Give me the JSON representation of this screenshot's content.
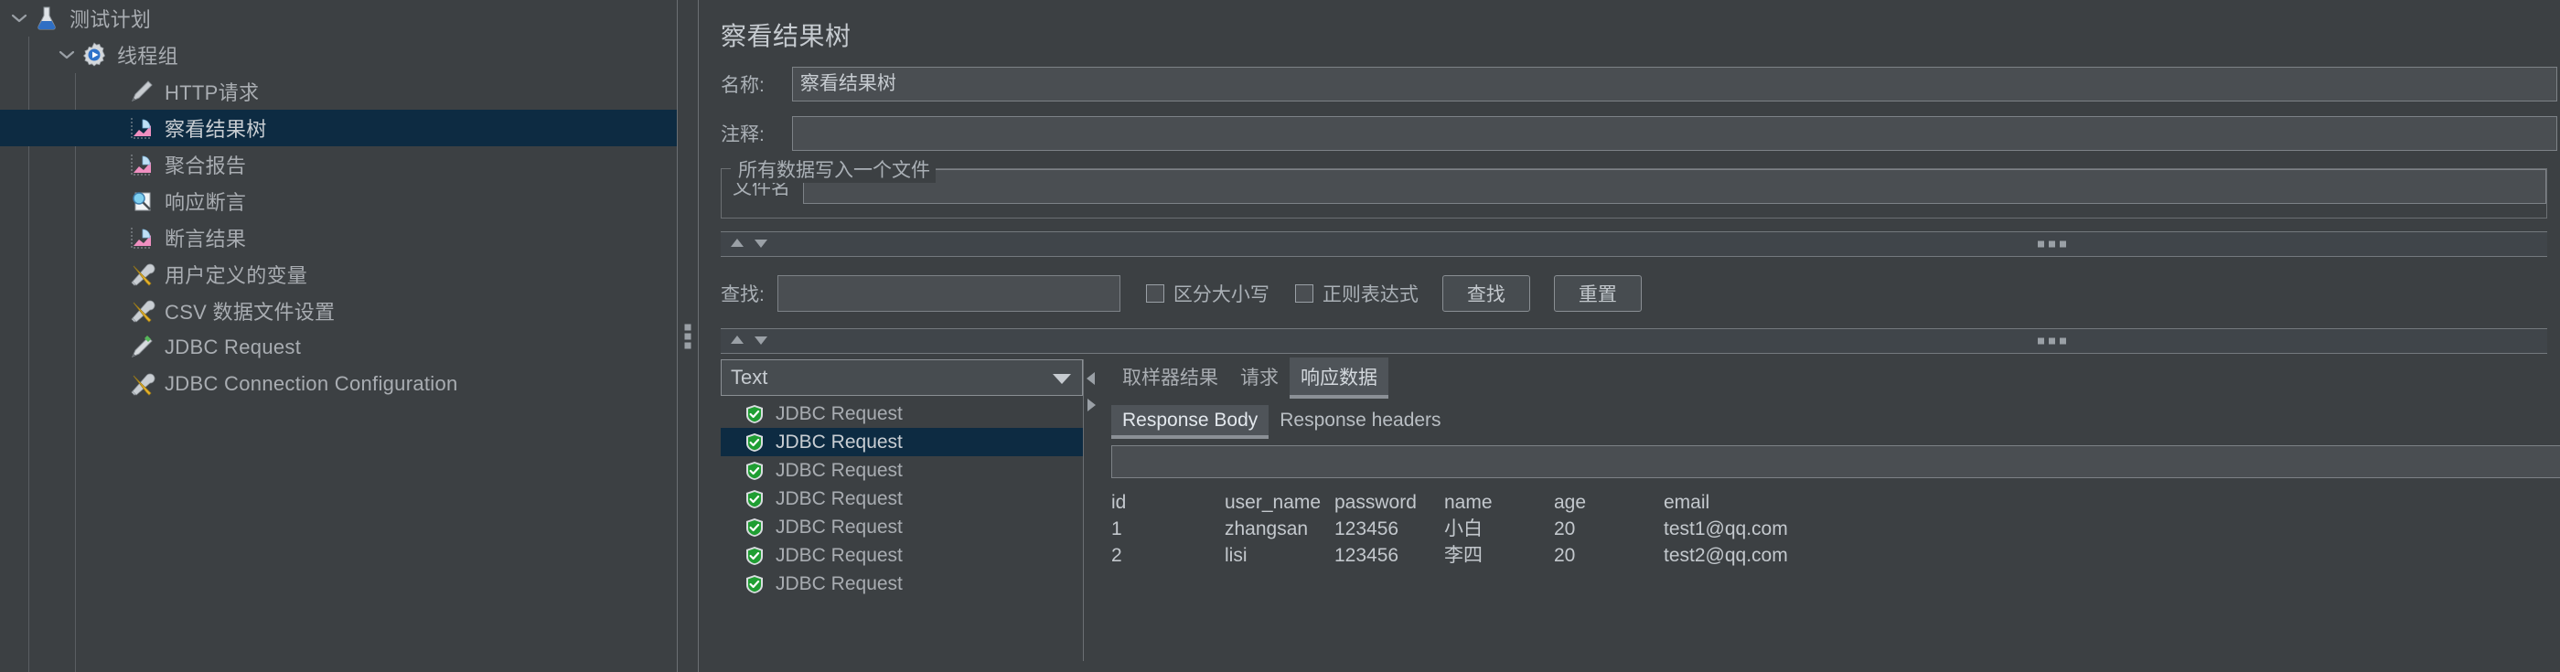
{
  "tree": {
    "items": [
      {
        "label": "测试计划",
        "icon": "flask-icon",
        "depth": 0,
        "twisty": "down",
        "selected": false
      },
      {
        "label": "线程组",
        "icon": "gear-play-icon",
        "depth": 1,
        "twisty": "down",
        "selected": false
      },
      {
        "label": "HTTP请求",
        "icon": "pencil-icon",
        "depth": 2,
        "twisty": "none",
        "selected": false
      },
      {
        "label": "察看结果树",
        "icon": "chart-icon",
        "depth": 2,
        "twisty": "none",
        "selected": true
      },
      {
        "label": "聚合报告",
        "icon": "chart-icon",
        "depth": 2,
        "twisty": "none",
        "selected": false
      },
      {
        "label": "响应断言",
        "icon": "magnifier-icon",
        "depth": 2,
        "twisty": "none",
        "selected": false
      },
      {
        "label": "断言结果",
        "icon": "chart-icon",
        "depth": 2,
        "twisty": "none",
        "selected": false
      },
      {
        "label": "用户定义的变量",
        "icon": "tools-icon",
        "depth": 2,
        "twisty": "none",
        "selected": false
      },
      {
        "label": "CSV 数据文件设置",
        "icon": "tools-icon",
        "depth": 2,
        "twisty": "none",
        "selected": false
      },
      {
        "label": "JDBC Request",
        "icon": "pencil-green-icon",
        "depth": 2,
        "twisty": "none",
        "selected": false
      },
      {
        "label": "JDBC Connection Configuration",
        "icon": "tools-icon",
        "depth": 2,
        "twisty": "none",
        "selected": false
      }
    ]
  },
  "panel": {
    "title": "察看结果树",
    "name_label": "名称:",
    "name_value": "察看结果树",
    "comment_label": "注释:",
    "comment_value": "",
    "file_group_title": "所有数据写入一个文件",
    "filename_label": "文件名",
    "filename_value": ""
  },
  "search": {
    "label": "查找:",
    "value": "",
    "case_sensitive_label": "区分大小写",
    "case_sensitive_checked": false,
    "regex_label": "正则表达式",
    "regex_checked": false,
    "find_button": "查找",
    "reset_button": "重置"
  },
  "results": {
    "render_select": "Text",
    "items": [
      {
        "label": "JDBC Request",
        "status": "success",
        "selected": false
      },
      {
        "label": "JDBC Request",
        "status": "success",
        "selected": true
      },
      {
        "label": "JDBC Request",
        "status": "success",
        "selected": false
      },
      {
        "label": "JDBC Request",
        "status": "success",
        "selected": false
      },
      {
        "label": "JDBC Request",
        "status": "success",
        "selected": false
      },
      {
        "label": "JDBC Request",
        "status": "success",
        "selected": false
      },
      {
        "label": "JDBC Request",
        "status": "success",
        "selected": false
      }
    ]
  },
  "detail": {
    "tabs": [
      {
        "label": "取样器结果",
        "active": false
      },
      {
        "label": "请求",
        "active": false
      },
      {
        "label": "响应数据",
        "active": true
      }
    ],
    "subtabs": [
      {
        "label": "Response Body",
        "active": true
      },
      {
        "label": "Response headers",
        "active": false
      }
    ],
    "body_search_value": ""
  },
  "response_table": {
    "headers": [
      "id",
      "user_name",
      "password",
      "name",
      "age",
      "email"
    ],
    "rows": [
      [
        "1",
        "zhangsan",
        "123456",
        "小白",
        "20",
        "test1@qq.com"
      ],
      [
        "2",
        "lisi",
        "123456",
        "李四",
        "20",
        "test2@qq.com"
      ]
    ]
  },
  "colors": {
    "bg": "#3c4043",
    "selection": "#0d2b42",
    "field_bg": "#4a4e52",
    "border": "#7d8287",
    "text": "#b8bdc2",
    "success_green": "#2aa63a"
  }
}
